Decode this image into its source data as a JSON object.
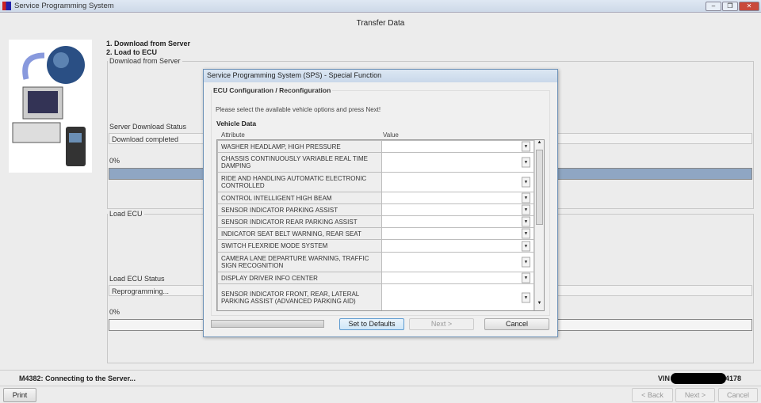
{
  "window": {
    "title": "Service Programming System"
  },
  "page": {
    "heading": "Transfer Data",
    "steps": [
      "1. Download from Server",
      "2. Load to ECU"
    ]
  },
  "download": {
    "legend": "Download from Server",
    "status_label": "Server Download Status",
    "status_value": "Download completed",
    "percent": "0%",
    "progress": 1.0
  },
  "load": {
    "legend": "Load ECU",
    "status_label": "Load ECU Status",
    "status_value": "Reprogramming...",
    "percent": "0%",
    "progress": 0.0
  },
  "statusbar": {
    "message": "M4382: Connecting to the Server...",
    "vin_label": "VIN",
    "vin_suffix": "4178"
  },
  "footer": {
    "print": "Print",
    "back": "< Back",
    "next": "Next >",
    "cancel": "Cancel"
  },
  "dialog": {
    "title": "Service Programming System (SPS) - Special Function",
    "group": "ECU Configuration / Reconfiguration",
    "instruction": "Please select the available vehicle options and press Next!",
    "section": "Vehicle Data",
    "col_attribute": "Attribute",
    "col_value": "Value",
    "rows": [
      {
        "attribute": "WASHER HEADLAMP, HIGH PRESSURE",
        "value": ""
      },
      {
        "attribute": "CHASSIS CONTINUOUSLY VARIABLE REAL TIME DAMPING",
        "value": ""
      },
      {
        "attribute": "RIDE AND HANDLING AUTOMATIC ELECTRONIC CONTROLLED",
        "value": ""
      },
      {
        "attribute": "CONTROL INTELLIGENT HIGH BEAM",
        "value": ""
      },
      {
        "attribute": "SENSOR INDICATOR PARKING ASSIST",
        "value": ""
      },
      {
        "attribute": "SENSOR INDICATOR REAR PARKING ASSIST",
        "value": ""
      },
      {
        "attribute": "INDICATOR SEAT BELT WARNING, REAR SEAT",
        "value": ""
      },
      {
        "attribute": "SWITCH FLEXRIDE MODE SYSTEM",
        "value": ""
      },
      {
        "attribute": "CAMERA LANE DEPARTURE WARNING, TRAFFIC SIGN RECOGNITION",
        "value": ""
      },
      {
        "attribute": "DISPLAY DRIVER INFO CENTER",
        "value": ""
      },
      {
        "attribute": "SENSOR INDICATOR FRONT, REAR, LATERAL PARKING ASSIST (ADVANCED PARKING AID)",
        "value": ""
      }
    ],
    "set_defaults": "Set to Defaults",
    "next": "Next >",
    "cancel": "Cancel"
  }
}
